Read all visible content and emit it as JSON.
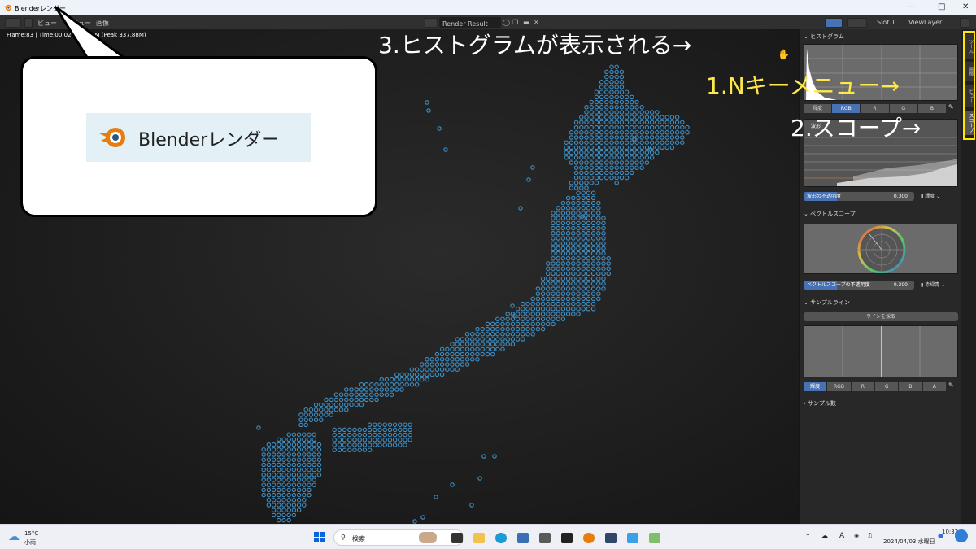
{
  "window": {
    "title": "Blenderレンダー"
  },
  "menu": {
    "view": "ビュー",
    "view2": "ビュー",
    "image": "画像",
    "slot": "Slot 1",
    "view_layer": "ViewLayer",
    "render_result": "Render Result"
  },
  "render_info": "Frame:83 | Time:00:02. 179.50M (Peak 337.88M)",
  "callout": {
    "text": "Blenderレンダー"
  },
  "annotations": {
    "a3": "3.ヒストグラムが表示される→",
    "a1": "1.Nキーメニュー→",
    "a2": "2.スコープ→"
  },
  "sidebar": {
    "tabs": [
      "ツール",
      "画像",
      "ビュー",
      "スコープ"
    ],
    "histogram": {
      "title": "ヒストグラム",
      "buttons": [
        "輝度",
        "RGB",
        "R",
        "G",
        "B"
      ],
      "active": "RGB"
    },
    "waveform": {
      "label": "波形",
      "opacity_label": "波形の不透明度",
      "opacity_value": "0.300",
      "opacity_fraction": 0.3,
      "mode": "輝度"
    },
    "vectorscope": {
      "title": "ベクトルスコープ",
      "opacity_label": "ベクトルスコープの不透明度",
      "opacity_value": "0.300",
      "opacity_fraction": 0.3,
      "mode": "赤緑青"
    },
    "sample_line": {
      "title": "サンプルライン",
      "sample_button": "ラインを採取",
      "buttons": [
        "輝度",
        "RGB",
        "R",
        "G",
        "B",
        "A"
      ],
      "active": "輝度"
    },
    "sample_count": {
      "title": "サンプル数"
    }
  },
  "taskbar": {
    "weather_temp": "15°C",
    "weather_desc": "小雨",
    "search": "検索",
    "time": "10:32",
    "date": "2024/04/03 水曜日",
    "tray_letter": "A"
  },
  "colors": {
    "dots": "#3f8fc4",
    "accent": "#4772b3",
    "annotation_yellow": "#ffe94a",
    "highlight_box": "#ffe600"
  }
}
